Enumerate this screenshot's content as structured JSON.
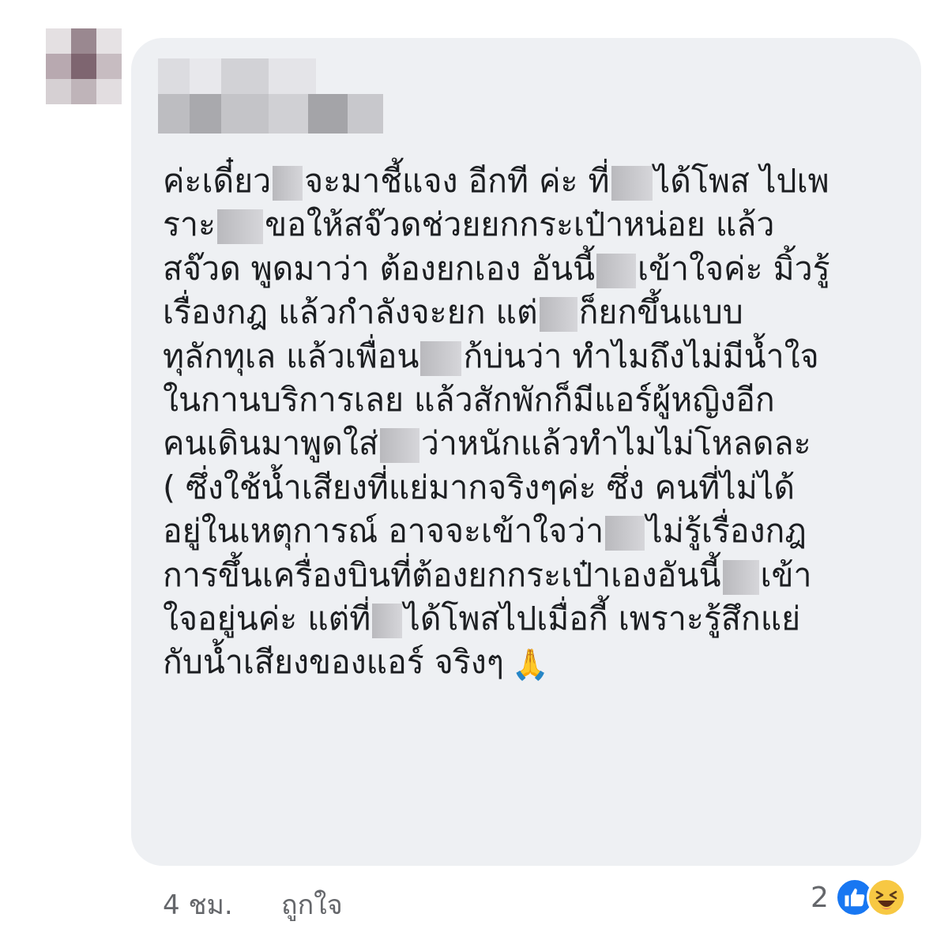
{
  "comment": {
    "lines": [
      "ค่ะเดี๋ยว",
      "จะมาชี้แจง อีกที ค่ะ ที่",
      "ได้โพส ไปเพ",
      "ราะ",
      "ขอให้สจ๊วดช่วยยกกระเป๋าหน่อย แล้ว",
      "สจ๊วด พูดมาว่า ต้องยกเอง อันนี้",
      "เข้าใจค่ะ มิ้วรู้",
      "เรื่องกฎ แล้วกำลังจะยก แต่",
      "ก็ยกขึ้นแบบ",
      "ทุลักทุเล แล้วเพื่อน",
      "ก้บ่นว่า ทำไมถึงไม่มีน้ำใจ",
      "ในกานบริการเลย แล้วสักพักก็มีแอร์ผู้หญิงอีก",
      "คนเดินมาพูดใส่",
      "ว่าหนักแล้วทำไมไม่โหลดละ",
      "( ซึ่งใช้น้ำเสียงที่แย่มากจริงๆค่ะ ซึ่ง คนที่ไม่ได้",
      "อยู่ในเหตุการณ์ อาจจะเข้าใจว่า",
      "ไม่รู้เรื่องกฎ",
      "การขึ้นเครื่องบินที่ต้องยกกระเป๋าเองอันนี้",
      "เข้า",
      "ใจอยู่นค่ะ แต่ที่",
      "ได้โพสไปเมื่อกี้ เพราะรู้สึกแย่",
      "กับน้ำเสียงของแอร์ จริงๆ"
    ],
    "emoji": "🙏"
  },
  "footer": {
    "time": "4 ชม.",
    "like_label": "ถูกใจ",
    "reaction_count": "2"
  },
  "reactions": [
    "like-icon",
    "haha-icon"
  ],
  "colors": {
    "bubble": "#eef0f3",
    "text": "#1c1e21",
    "meta": "#65676b",
    "like": "#1877f2",
    "haha": "#f7c843"
  }
}
